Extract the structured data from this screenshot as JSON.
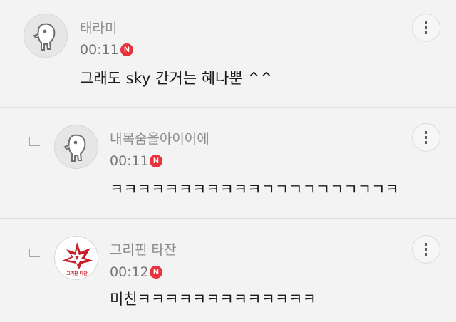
{
  "comments": [
    {
      "username": "태라미",
      "time": "00:11",
      "badge": "N",
      "text": "그래도 sky 간거는 혜나뿐 ^^",
      "avatar": "default-character-avatar",
      "is_reply": false
    },
    {
      "username": "내목숨을아이어에",
      "time": "00:11",
      "badge": "N",
      "text": "ㅋㅋㅋㅋㅋㅋㅋㅋㅋㅋㅋㄱㄱㄱㄱㄱㄱㄱㄱㄱㅋ",
      "avatar": "default-character-avatar",
      "is_reply": true
    },
    {
      "username": "그리핀 타잔",
      "time": "00:12",
      "badge": "N",
      "text": "미친ㅋㅋㅋㅋㅋㅋㅋㅋㅋㅋㅋㅋㅋ",
      "avatar": "griffin-team-logo",
      "avatar_caption": "그리핀 타잔",
      "is_reply": true
    }
  ],
  "icons": {
    "more": "more-vertical-icon",
    "reply": "reply-arrow-icon",
    "new": "new-badge-icon"
  },
  "colors": {
    "background": "#f2f3f2",
    "badge": "#e8333e",
    "logo_red": "#c8202a"
  }
}
